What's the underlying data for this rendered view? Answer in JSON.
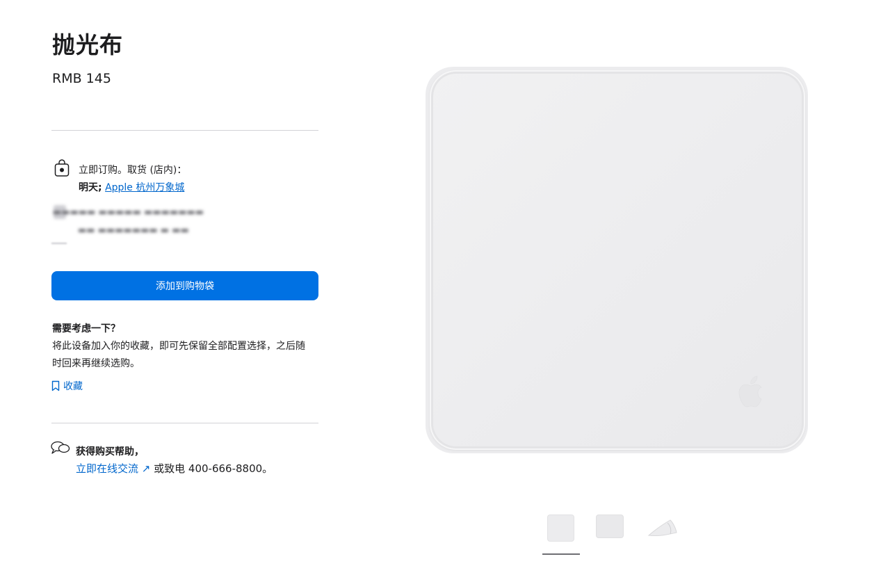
{
  "product": {
    "title": "抛光布",
    "price": "RMB 145"
  },
  "pickup": {
    "line1": "立即订购。取货 (店内)：",
    "day": "明天;",
    "store_link": "Apple 杭州万象城"
  },
  "add_to_bag": {
    "label": "添加到购物袋"
  },
  "consider": {
    "heading": "需要考虑一下？",
    "body": "将此设备加入你的收藏，即可先保留全部配置选择，之后随时回来再继续选购。",
    "save_label": "收藏"
  },
  "help": {
    "heading": "获得购买帮助，",
    "chat_link": "立即在线交流",
    "or_call": " 或致电 400-666-8800。"
  },
  "colors": {
    "accent": "#0071e3",
    "link": "#0066cc",
    "text": "#1d1d1f",
    "divider": "#d2d2d7"
  },
  "icons": [
    "shopping-bag-icon",
    "bookmark-icon",
    "chat-bubbles-icon",
    "external-arrow-icon",
    "apple-logo-icon"
  ]
}
